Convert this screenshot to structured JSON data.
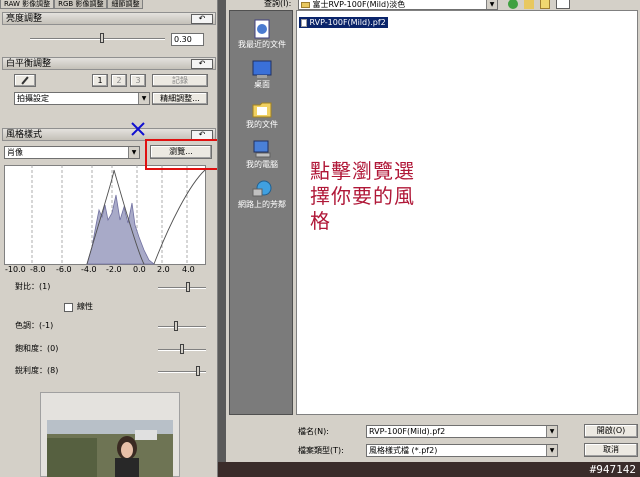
{
  "left_panel": {
    "tabs": [
      "RAW 影像調整",
      "RGB 影像調整",
      "細節調整"
    ],
    "brightness": {
      "title": "亮度調整",
      "value": "0.30"
    },
    "white_balance": {
      "title": "白平衡調整",
      "presets": [
        "1",
        "2",
        "3"
      ],
      "register_label": "記錄",
      "mode": "拍攝設定",
      "fine_label": "精細調整..."
    },
    "picture_style": {
      "title": "風格樣式",
      "selected": "肖像",
      "browse_label": "瀏覽...",
      "axis_ticks": [
        "-10.0",
        "-8.0",
        "-6.0",
        "-4.0",
        "-2.0",
        "0.0",
        "2.0",
        "4.0"
      ]
    },
    "contrast": {
      "label": "對比：(1)"
    },
    "linear": {
      "label": "線性"
    },
    "tone": {
      "label": "色調：(-1)"
    },
    "saturation": {
      "label": "飽和度：(0)"
    },
    "sharpness": {
      "label": "銳利度：(8)"
    }
  },
  "dialog": {
    "lookin_label": "查詢(I):",
    "lookin_value": "富士RVP-100F(Mild)淡色",
    "places": [
      "我最近的文件",
      "桌面",
      "我的文件",
      "我的電腦",
      "網路上的芳鄰"
    ],
    "files": [
      "RVP-100F(Mild).pf2"
    ],
    "filename_label": "檔名(N):",
    "filename_value": "RVP-100F(Mild).pf2",
    "filetype_label": "檔案類型(T):",
    "filetype_value": "風格樣式檔 (*.pf2)",
    "open_label": "開啟(O)",
    "cancel_label": "取消"
  },
  "annotation": {
    "lines": [
      "點擊瀏覽選",
      "擇你要的風",
      "格"
    ]
  },
  "watermark": "#947142",
  "colors": {
    "annotation": "#b01838",
    "highlight_box": "#e01010",
    "cross": "#1010d0",
    "selection": "#0a246a"
  }
}
